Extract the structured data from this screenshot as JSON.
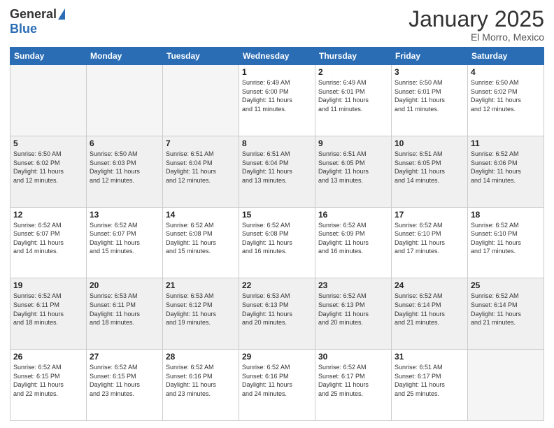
{
  "logo": {
    "general": "General",
    "blue": "Blue"
  },
  "title": "January 2025",
  "location": "El Morro, Mexico",
  "days_of_week": [
    "Sunday",
    "Monday",
    "Tuesday",
    "Wednesday",
    "Thursday",
    "Friday",
    "Saturday"
  ],
  "weeks": [
    [
      {
        "day": "",
        "info": ""
      },
      {
        "day": "",
        "info": ""
      },
      {
        "day": "",
        "info": ""
      },
      {
        "day": "1",
        "info": "Sunrise: 6:49 AM\nSunset: 6:00 PM\nDaylight: 11 hours\nand 11 minutes."
      },
      {
        "day": "2",
        "info": "Sunrise: 6:49 AM\nSunset: 6:01 PM\nDaylight: 11 hours\nand 11 minutes."
      },
      {
        "day": "3",
        "info": "Sunrise: 6:50 AM\nSunset: 6:01 PM\nDaylight: 11 hours\nand 11 minutes."
      },
      {
        "day": "4",
        "info": "Sunrise: 6:50 AM\nSunset: 6:02 PM\nDaylight: 11 hours\nand 12 minutes."
      }
    ],
    [
      {
        "day": "5",
        "info": "Sunrise: 6:50 AM\nSunset: 6:02 PM\nDaylight: 11 hours\nand 12 minutes."
      },
      {
        "day": "6",
        "info": "Sunrise: 6:50 AM\nSunset: 6:03 PM\nDaylight: 11 hours\nand 12 minutes."
      },
      {
        "day": "7",
        "info": "Sunrise: 6:51 AM\nSunset: 6:04 PM\nDaylight: 11 hours\nand 12 minutes."
      },
      {
        "day": "8",
        "info": "Sunrise: 6:51 AM\nSunset: 6:04 PM\nDaylight: 11 hours\nand 13 minutes."
      },
      {
        "day": "9",
        "info": "Sunrise: 6:51 AM\nSunset: 6:05 PM\nDaylight: 11 hours\nand 13 minutes."
      },
      {
        "day": "10",
        "info": "Sunrise: 6:51 AM\nSunset: 6:05 PM\nDaylight: 11 hours\nand 14 minutes."
      },
      {
        "day": "11",
        "info": "Sunrise: 6:52 AM\nSunset: 6:06 PM\nDaylight: 11 hours\nand 14 minutes."
      }
    ],
    [
      {
        "day": "12",
        "info": "Sunrise: 6:52 AM\nSunset: 6:07 PM\nDaylight: 11 hours\nand 14 minutes."
      },
      {
        "day": "13",
        "info": "Sunrise: 6:52 AM\nSunset: 6:07 PM\nDaylight: 11 hours\nand 15 minutes."
      },
      {
        "day": "14",
        "info": "Sunrise: 6:52 AM\nSunset: 6:08 PM\nDaylight: 11 hours\nand 15 minutes."
      },
      {
        "day": "15",
        "info": "Sunrise: 6:52 AM\nSunset: 6:08 PM\nDaylight: 11 hours\nand 16 minutes."
      },
      {
        "day": "16",
        "info": "Sunrise: 6:52 AM\nSunset: 6:09 PM\nDaylight: 11 hours\nand 16 minutes."
      },
      {
        "day": "17",
        "info": "Sunrise: 6:52 AM\nSunset: 6:10 PM\nDaylight: 11 hours\nand 17 minutes."
      },
      {
        "day": "18",
        "info": "Sunrise: 6:52 AM\nSunset: 6:10 PM\nDaylight: 11 hours\nand 17 minutes."
      }
    ],
    [
      {
        "day": "19",
        "info": "Sunrise: 6:52 AM\nSunset: 6:11 PM\nDaylight: 11 hours\nand 18 minutes."
      },
      {
        "day": "20",
        "info": "Sunrise: 6:53 AM\nSunset: 6:11 PM\nDaylight: 11 hours\nand 18 minutes."
      },
      {
        "day": "21",
        "info": "Sunrise: 6:53 AM\nSunset: 6:12 PM\nDaylight: 11 hours\nand 19 minutes."
      },
      {
        "day": "22",
        "info": "Sunrise: 6:53 AM\nSunset: 6:13 PM\nDaylight: 11 hours\nand 20 minutes."
      },
      {
        "day": "23",
        "info": "Sunrise: 6:52 AM\nSunset: 6:13 PM\nDaylight: 11 hours\nand 20 minutes."
      },
      {
        "day": "24",
        "info": "Sunrise: 6:52 AM\nSunset: 6:14 PM\nDaylight: 11 hours\nand 21 minutes."
      },
      {
        "day": "25",
        "info": "Sunrise: 6:52 AM\nSunset: 6:14 PM\nDaylight: 11 hours\nand 21 minutes."
      }
    ],
    [
      {
        "day": "26",
        "info": "Sunrise: 6:52 AM\nSunset: 6:15 PM\nDaylight: 11 hours\nand 22 minutes."
      },
      {
        "day": "27",
        "info": "Sunrise: 6:52 AM\nSunset: 6:15 PM\nDaylight: 11 hours\nand 23 minutes."
      },
      {
        "day": "28",
        "info": "Sunrise: 6:52 AM\nSunset: 6:16 PM\nDaylight: 11 hours\nand 23 minutes."
      },
      {
        "day": "29",
        "info": "Sunrise: 6:52 AM\nSunset: 6:16 PM\nDaylight: 11 hours\nand 24 minutes."
      },
      {
        "day": "30",
        "info": "Sunrise: 6:52 AM\nSunset: 6:17 PM\nDaylight: 11 hours\nand 25 minutes."
      },
      {
        "day": "31",
        "info": "Sunrise: 6:51 AM\nSunset: 6:17 PM\nDaylight: 11 hours\nand 25 minutes."
      },
      {
        "day": "",
        "info": ""
      }
    ]
  ]
}
